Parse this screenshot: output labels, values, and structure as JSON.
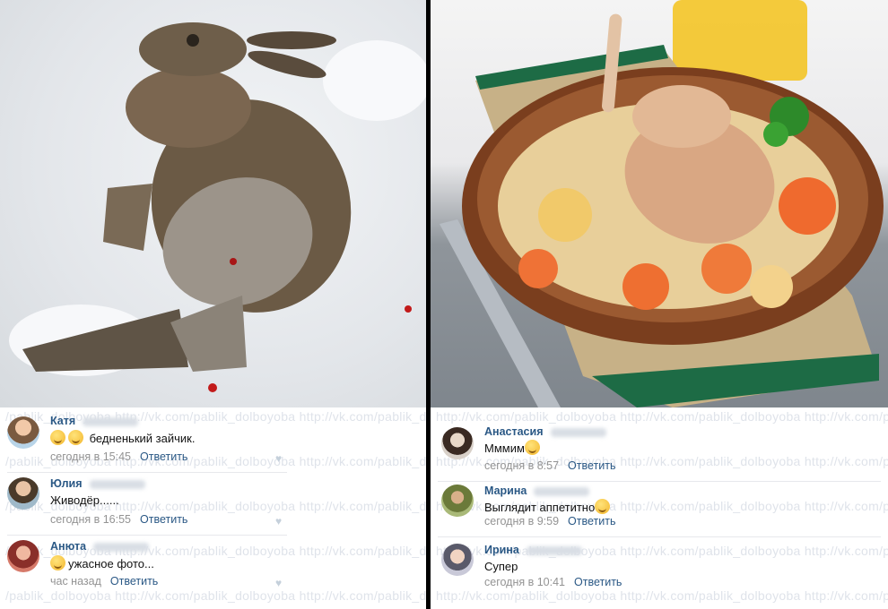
{
  "left": {
    "watermark": "/pablik_dolboyoba http://vk.com/pablik_dolboyoba http://vk.com/pablik_dolboyoba http://vk.com/pablik_dolboyoba",
    "comments": [
      {
        "author": "Катя",
        "text": "бедненький зайчик.",
        "time": "сегодня в 15:45",
        "reply": "Ответить",
        "emoji": "sad-face-emoji"
      },
      {
        "author": "Юлия",
        "text": "Живодёр......",
        "time": "сегодня в 16:55",
        "reply": "Ответить"
      },
      {
        "author": "Анюта",
        "text": "ужасное фото...",
        "time": "час назад",
        "reply": "Ответить",
        "emoji": "sad-face-emoji"
      }
    ]
  },
  "right": {
    "watermark": "http://vk.com/pablik_dolboyoba http://vk.com/pablik_dolboyoba http://vk.com/pablik_dolboyoba",
    "comments": [
      {
        "author": "Анастасия",
        "text": "Мммим",
        "time": "сегодня в 8:57",
        "reply": "Ответить",
        "emoji": "smile-emoji"
      },
      {
        "author": "Марина",
        "text": "Выглядит аппетитно",
        "time": "сегодня в 9:59",
        "reply": "Ответить",
        "emoji": "smile-emoji"
      },
      {
        "author": "Ирина",
        "text": "Супер",
        "time": "сегодня в 10:41",
        "reply": "Ответить"
      }
    ]
  },
  "colors": {
    "link": "#2a5885",
    "meta": "#939393",
    "divider": "#000000"
  }
}
